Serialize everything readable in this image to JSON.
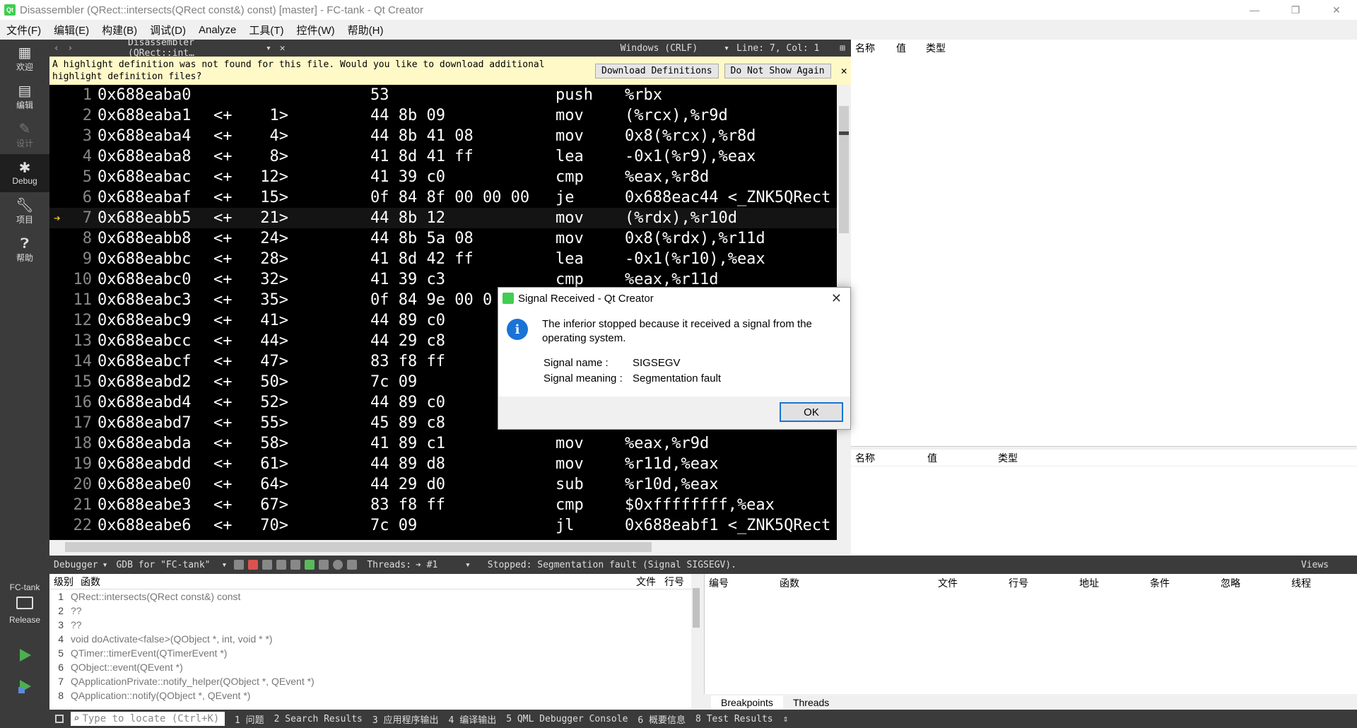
{
  "window": {
    "title": "Disassembler (QRect::intersects(QRect const&) const) [master] - FC-tank - Qt Creator",
    "controls": [
      "—",
      "❐",
      "✕"
    ]
  },
  "menu": [
    "文件(F)",
    "编辑(E)",
    "构建(B)",
    "调试(D)",
    "Analyze",
    "工具(T)",
    "控件(W)",
    "帮助(H)"
  ],
  "modes": [
    {
      "label": "欢迎",
      "icon": "grid-icon"
    },
    {
      "label": "编辑",
      "icon": "document-icon"
    },
    {
      "label": "设计",
      "icon": "pencil-icon"
    },
    {
      "label": "Debug",
      "icon": "bug-icon"
    },
    {
      "label": "项目",
      "icon": "wrench-icon"
    },
    {
      "label": "帮助",
      "icon": "help-icon"
    }
  ],
  "kit": {
    "project": "FC-tank",
    "config": "Release"
  },
  "editor_toolbar": {
    "document": "Disassembler (QRect::int…",
    "encoding": "Windows (CRLF)",
    "position": "Line: 7, Col: 1"
  },
  "infobar": {
    "message": "A highlight definition was not found for this file. Would you like to download additional highlight definition files?",
    "download": "Download Definitions",
    "dismiss": "Do Not Show Again"
  },
  "disassembly": [
    {
      "n": "1",
      "addr": "0x688eaba0",
      "off": "",
      "bytes": "53",
      "ins": "push",
      "ops": "%rbx"
    },
    {
      "n": "2",
      "addr": "0x688eaba1",
      "off": "<+    1>",
      "bytes": "44 8b 09",
      "ins": "mov",
      "ops": "(%rcx),%r9d"
    },
    {
      "n": "3",
      "addr": "0x688eaba4",
      "off": "<+    4>",
      "bytes": "44 8b 41 08",
      "ins": "mov",
      "ops": "0x8(%rcx),%r8d"
    },
    {
      "n": "4",
      "addr": "0x688eaba8",
      "off": "<+    8>",
      "bytes": "41 8d 41 ff",
      "ins": "lea",
      "ops": "-0x1(%r9),%eax"
    },
    {
      "n": "5",
      "addr": "0x688eabac",
      "off": "<+   12>",
      "bytes": "41 39 c0",
      "ins": "cmp",
      "ops": "%eax,%r8d"
    },
    {
      "n": "6",
      "addr": "0x688eabaf",
      "off": "<+   15>",
      "bytes": "0f 84 8f 00 00 00",
      "ins": "je",
      "ops": "0x688eac44 <_ZNK5QRect"
    },
    {
      "n": "7",
      "addr": "0x688eabb5",
      "off": "<+   21>",
      "bytes": "44 8b 12",
      "ins": "mov",
      "ops": "(%rdx),%r10d"
    },
    {
      "n": "8",
      "addr": "0x688eabb8",
      "off": "<+   24>",
      "bytes": "44 8b 5a 08",
      "ins": "mov",
      "ops": "0x8(%rdx),%r11d"
    },
    {
      "n": "9",
      "addr": "0x688eabbc",
      "off": "<+   28>",
      "bytes": "41 8d 42 ff",
      "ins": "lea",
      "ops": "-0x1(%r10),%eax"
    },
    {
      "n": "10",
      "addr": "0x688eabc0",
      "off": "<+   32>",
      "bytes": "41 39 c3",
      "ins": "cmp",
      "ops": "%eax,%r11d"
    },
    {
      "n": "11",
      "addr": "0x688eabc3",
      "off": "<+   35>",
      "bytes": "0f 84 9e 00 0",
      "ins": "",
      "ops": ""
    },
    {
      "n": "12",
      "addr": "0x688eabc9",
      "off": "<+   41>",
      "bytes": "44 89 c0",
      "ins": "",
      "ops": ""
    },
    {
      "n": "13",
      "addr": "0x688eabcc",
      "off": "<+   44>",
      "bytes": "44 29 c8",
      "ins": "",
      "ops": ""
    },
    {
      "n": "14",
      "addr": "0x688eabcf",
      "off": "<+   47>",
      "bytes": "83 f8 ff",
      "ins": "",
      "ops": ""
    },
    {
      "n": "15",
      "addr": "0x688eabd2",
      "off": "<+   50>",
      "bytes": "7c 09",
      "ins": "",
      "ops": ""
    },
    {
      "n": "16",
      "addr": "0x688eabd4",
      "off": "<+   52>",
      "bytes": "44 89 c0",
      "ins": "",
      "ops": ""
    },
    {
      "n": "17",
      "addr": "0x688eabd7",
      "off": "<+   55>",
      "bytes": "45 89 c8",
      "ins": "",
      "ops": ""
    },
    {
      "n": "18",
      "addr": "0x688eabda",
      "off": "<+   58>",
      "bytes": "41 89 c1",
      "ins": "mov",
      "ops": "%eax,%r9d"
    },
    {
      "n": "19",
      "addr": "0x688eabdd",
      "off": "<+   61>",
      "bytes": "44 89 d8",
      "ins": "mov",
      "ops": "%r11d,%eax"
    },
    {
      "n": "20",
      "addr": "0x688eabe0",
      "off": "<+   64>",
      "bytes": "44 29 d0",
      "ins": "sub",
      "ops": "%r10d,%eax"
    },
    {
      "n": "21",
      "addr": "0x688eabe3",
      "off": "<+   67>",
      "bytes": "83 f8 ff",
      "ins": "cmp",
      "ops": "$0xffffffff,%eax"
    },
    {
      "n": "22",
      "addr": "0x688eabe6",
      "off": "<+   70>",
      "bytes": "7c 09",
      "ins": "jl",
      "ops": "0x688eabf1 <_ZNK5QRect"
    }
  ],
  "current_line": "7",
  "locals_header": [
    "名称",
    "值",
    "类型"
  ],
  "debugger_toolbar": {
    "panel": "Debugger",
    "engine": "GDB for \"FC-tank\"",
    "threads_label": "Threads:",
    "thread": "➔ #1",
    "status": "Stopped: Segmentation fault (Signal SIGSEGV).",
    "views": "Views"
  },
  "stack_header": {
    "level": "级别",
    "function": "函数",
    "file": "文件",
    "line": "行号"
  },
  "stack": [
    {
      "level": "1",
      "function": "QRect::intersects(QRect const&) const"
    },
    {
      "level": "2",
      "function": "??"
    },
    {
      "level": "3",
      "function": "??"
    },
    {
      "level": "4",
      "function": "void doActivate<false>(QObject *, int, void * *)"
    },
    {
      "level": "5",
      "function": "QTimer::timerEvent(QTimerEvent *)"
    },
    {
      "level": "6",
      "function": "QObject::event(QEvent *)"
    },
    {
      "level": "7",
      "function": "QApplicationPrivate::notify_helper(QObject *, QEvent *)"
    },
    {
      "level": "8",
      "function": "QApplication::notify(QObject *, QEvent *)"
    }
  ],
  "breakpoints_header": [
    "编号",
    "函数",
    "文件",
    "行号",
    "地址",
    "条件",
    "忽略",
    "线程"
  ],
  "breakpoint_tabs": [
    "Breakpoints",
    "Threads"
  ],
  "statusbar": {
    "locator_placeholder": "Type to locate (Ctrl+K)",
    "panes": [
      "1 问题",
      "2 Search Results",
      "3 应用程序输出",
      "4 编译输出",
      "5 QML Debugger Console",
      "6 概要信息",
      "8 Test Results"
    ]
  },
  "dialog": {
    "title": "Signal Received - Qt Creator",
    "message": "The inferior stopped because it received a signal from the operating system.",
    "name_label": "Signal name :",
    "name_value": "SIGSEGV",
    "meaning_label": "Signal meaning :",
    "meaning_value": "Segmentation fault",
    "ok": "OK"
  },
  "colors": {
    "accent": "#1a73d6",
    "qt_green": "#41cd52",
    "current_arrow": "#f5c518",
    "dark_panel": "#3b3b3b"
  }
}
